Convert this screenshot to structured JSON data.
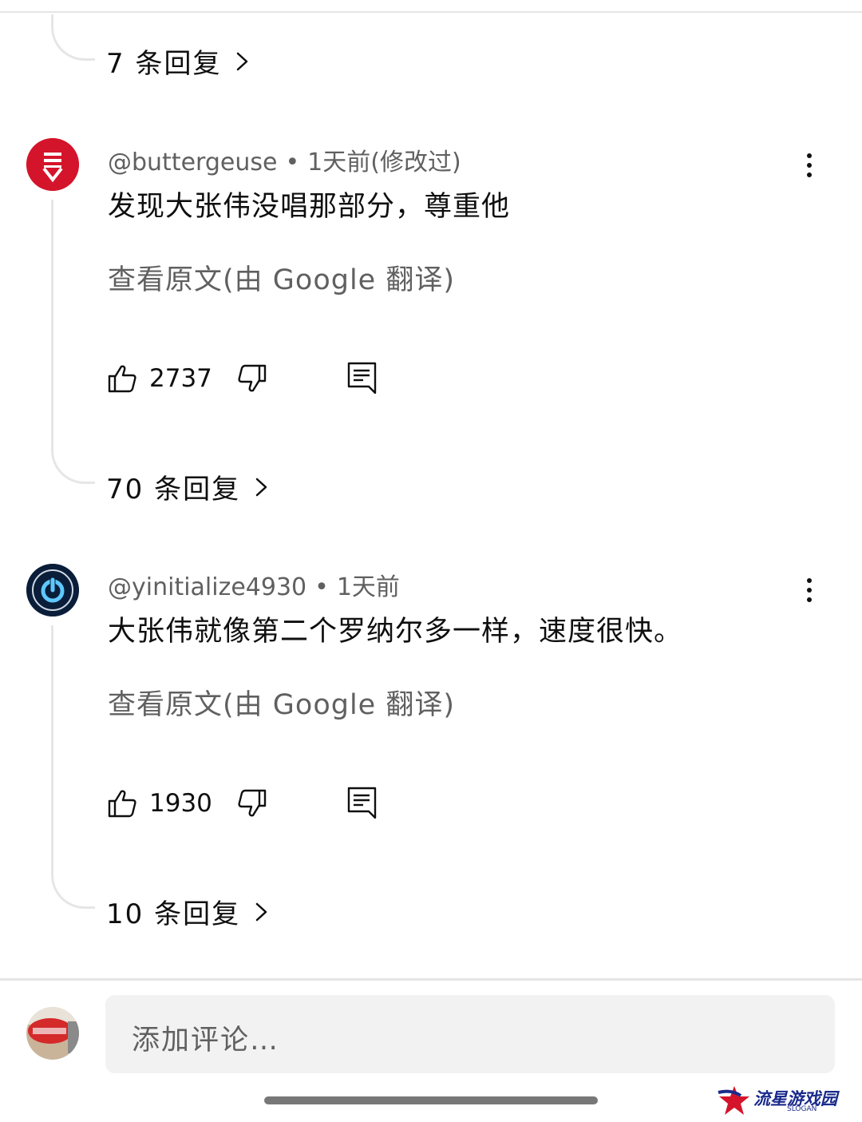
{
  "top_thread": {
    "replies_label": "7 条回复"
  },
  "comments": [
    {
      "username": "@buttergeuse",
      "time": "1天前(修改过)",
      "text": "发现大张伟没唱那部分，尊重他",
      "translate_note": "查看原文(由 Google 翻译)",
      "likes": "2737",
      "replies_label": "70 条回复",
      "avatar_color": "#d4142a"
    },
    {
      "username": "@yinitialize4930",
      "time": "1天前",
      "text": "大张伟就像第二个罗纳尔多一样，速度很快。",
      "translate_note": "查看原文(由 Google 翻译)",
      "likes": "1930",
      "replies_label": "10 条回复",
      "avatar_color": "#0a1e3a"
    }
  ],
  "dot_separator": "•",
  "comment_input": {
    "placeholder": "添加评论…"
  },
  "watermark": {
    "text": "流星游戏园",
    "slogan": "SLOGAN"
  },
  "colors": {
    "accent_avatar_red": "#d4142a",
    "placeholder_gray": "#606060",
    "watermark_blue": "#1a2a8c"
  }
}
